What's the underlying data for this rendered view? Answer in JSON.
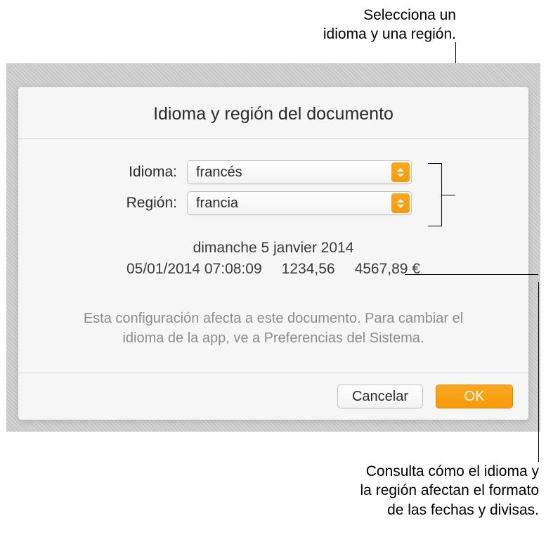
{
  "callouts": {
    "top": {
      "line1": "Selecciona un",
      "line2": "idioma y una región."
    },
    "bottom": {
      "line1": "Consulta cómo el idioma y",
      "line2": "la región afectan el formato",
      "line3": "de las fechas y divisas."
    }
  },
  "dialog": {
    "title": "Idioma y región del documento",
    "labels": {
      "language": "Idioma:",
      "region": "Región:"
    },
    "values": {
      "language": "francés",
      "region": "francia"
    },
    "preview": {
      "long_date": "dimanche 5 janvier 2014",
      "short_datetime": "05/01/2014 07:08:09",
      "number": "1234,56",
      "currency": "4567,89 €"
    },
    "helper": "Esta configuración afecta a este documento. Para cambiar el idioma de la app, ve a Preferencias del Sistema.",
    "buttons": {
      "cancel": "Cancelar",
      "ok": "OK"
    }
  }
}
